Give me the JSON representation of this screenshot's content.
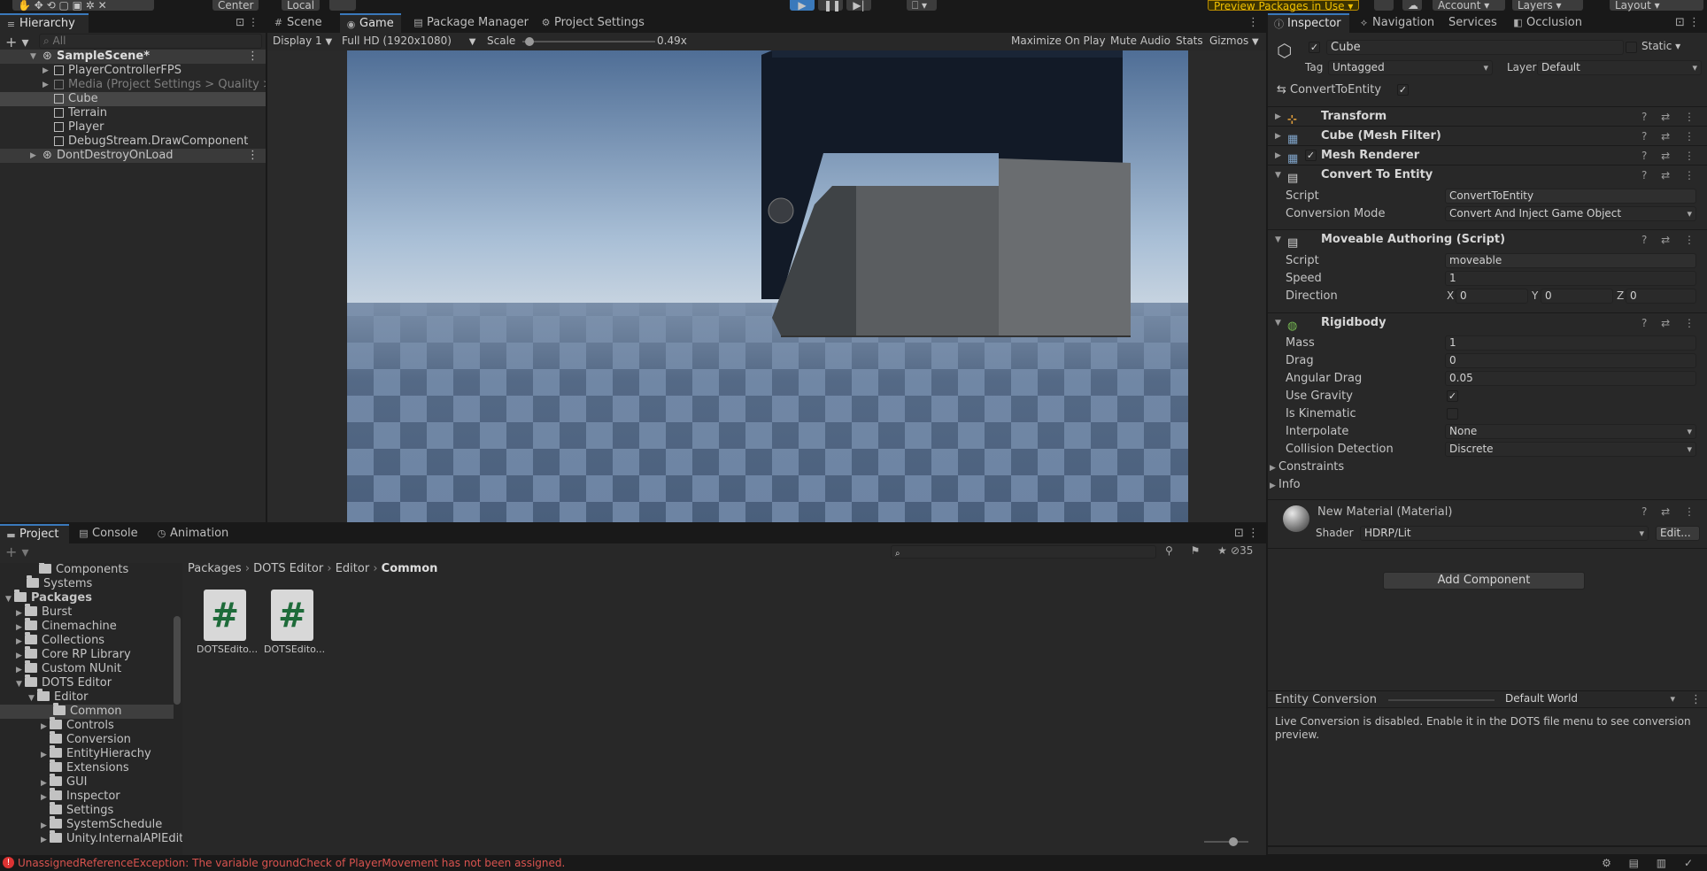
{
  "toolbar": {
    "center_label": "Center",
    "local_label": "Local",
    "preview_packages_label": "Preview Packages in Use",
    "account_label": "Account",
    "layers_label": "Layers",
    "layout_label": "Layout"
  },
  "hierarchy": {
    "tab_label": "Hierarchy",
    "search_placeholder": "All",
    "items": [
      {
        "label": "SampleScene*"
      },
      {
        "label": "PlayerControllerFPS"
      },
      {
        "label": "Media (Project Settings > Quality > High"
      },
      {
        "label": "Cube"
      },
      {
        "label": "Terrain"
      },
      {
        "label": "Player"
      },
      {
        "label": "DebugStream.DrawComponent"
      },
      {
        "label": "DontDestroyOnLoad"
      }
    ]
  },
  "center_tabs": {
    "scene": "Scene",
    "game": "Game",
    "package_manager": "Package Manager",
    "project_settings": "Project Settings"
  },
  "game_toolbar": {
    "display": "Display 1",
    "resolution": "Full HD (1920x1080)",
    "scale_label": "Scale",
    "scale_value": "0.49x",
    "scale_fraction": 0.02,
    "maximize": "Maximize On Play",
    "mute": "Mute Audio",
    "stats": "Stats",
    "gizmos": "Gizmos"
  },
  "inspector_tabs": {
    "inspector": "Inspector",
    "navigation": "Navigation",
    "services": "Services",
    "occlusion": "Occlusion"
  },
  "inspector": {
    "object_name": "Cube",
    "static_label": "Static",
    "tag_label": "Tag",
    "tag_value": "Untagged",
    "layer_label": "Layer",
    "layer_value": "Default",
    "convert_label": "ConvertToEntity",
    "components": {
      "transform": "Transform",
      "mesh_filter": "Cube (Mesh Filter)",
      "mesh_renderer": "Mesh Renderer",
      "convert": "Convert To Entity",
      "moveable": "Moveable Authoring (Script)",
      "rigidbody": "Rigidbody"
    },
    "convert_props": {
      "script_label": "Script",
      "script_value": "ConvertToEntity",
      "mode_label": "Conversion Mode",
      "mode_value": "Convert And Inject Game Object"
    },
    "moveable_props": {
      "script_label": "Script",
      "script_value": "moveable",
      "speed_label": "Speed",
      "speed_value": "1",
      "direction_label": "Direction",
      "x_label": "X",
      "x_value": "0",
      "y_label": "Y",
      "y_value": "0",
      "z_label": "Z",
      "z_value": "0"
    },
    "rigidbody_props": {
      "mass_label": "Mass",
      "mass_value": "1",
      "drag_label": "Drag",
      "drag_value": "0",
      "angular_label": "Angular Drag",
      "angular_value": "0.05",
      "gravity_label": "Use Gravity",
      "kinematic_label": "Is Kinematic",
      "interpolate_label": "Interpolate",
      "interpolate_value": "None",
      "collision_label": "Collision Detection",
      "collision_value": "Discrete",
      "constraints_label": "Constraints",
      "info_label": "Info"
    },
    "material": {
      "name": "New Material (Material)",
      "shader_label": "Shader",
      "shader_value": "HDRP/Lit",
      "edit_label": "Edit..."
    },
    "add_component": "Add Component",
    "entity_conversion": {
      "title": "Entity Conversion",
      "world": "Default World",
      "message": "Live Conversion is disabled. Enable it in the DOTS file menu to see conversion preview."
    }
  },
  "bottom_tabs": {
    "project": "Project",
    "console": "Console",
    "animation": "Animation"
  },
  "project": {
    "hidden_count": "35",
    "tree": [
      {
        "label": "Components"
      },
      {
        "label": "Systems"
      },
      {
        "label": "Packages"
      },
      {
        "label": "Burst"
      },
      {
        "label": "Cinemachine"
      },
      {
        "label": "Collections"
      },
      {
        "label": "Core RP Library"
      },
      {
        "label": "Custom NUnit"
      },
      {
        "label": "DOTS Editor"
      },
      {
        "label": "Editor"
      },
      {
        "label": "Common"
      },
      {
        "label": "Controls"
      },
      {
        "label": "Conversion"
      },
      {
        "label": "EntityHierachy"
      },
      {
        "label": "Extensions"
      },
      {
        "label": "GUI"
      },
      {
        "label": "Inspector"
      },
      {
        "label": "Settings"
      },
      {
        "label": "SystemSchedule"
      },
      {
        "label": "Unity.InternalAPIEdit"
      }
    ],
    "breadcrumb": [
      "Packages",
      "DOTS Editor",
      "Editor",
      "Common"
    ],
    "assets": [
      {
        "label": "DOTSEdito..."
      },
      {
        "label": "DOTSEdito..."
      }
    ]
  },
  "status": {
    "error": "UnassignedReferenceException: The variable groundCheck of PlayerMovement has not been assigned."
  }
}
